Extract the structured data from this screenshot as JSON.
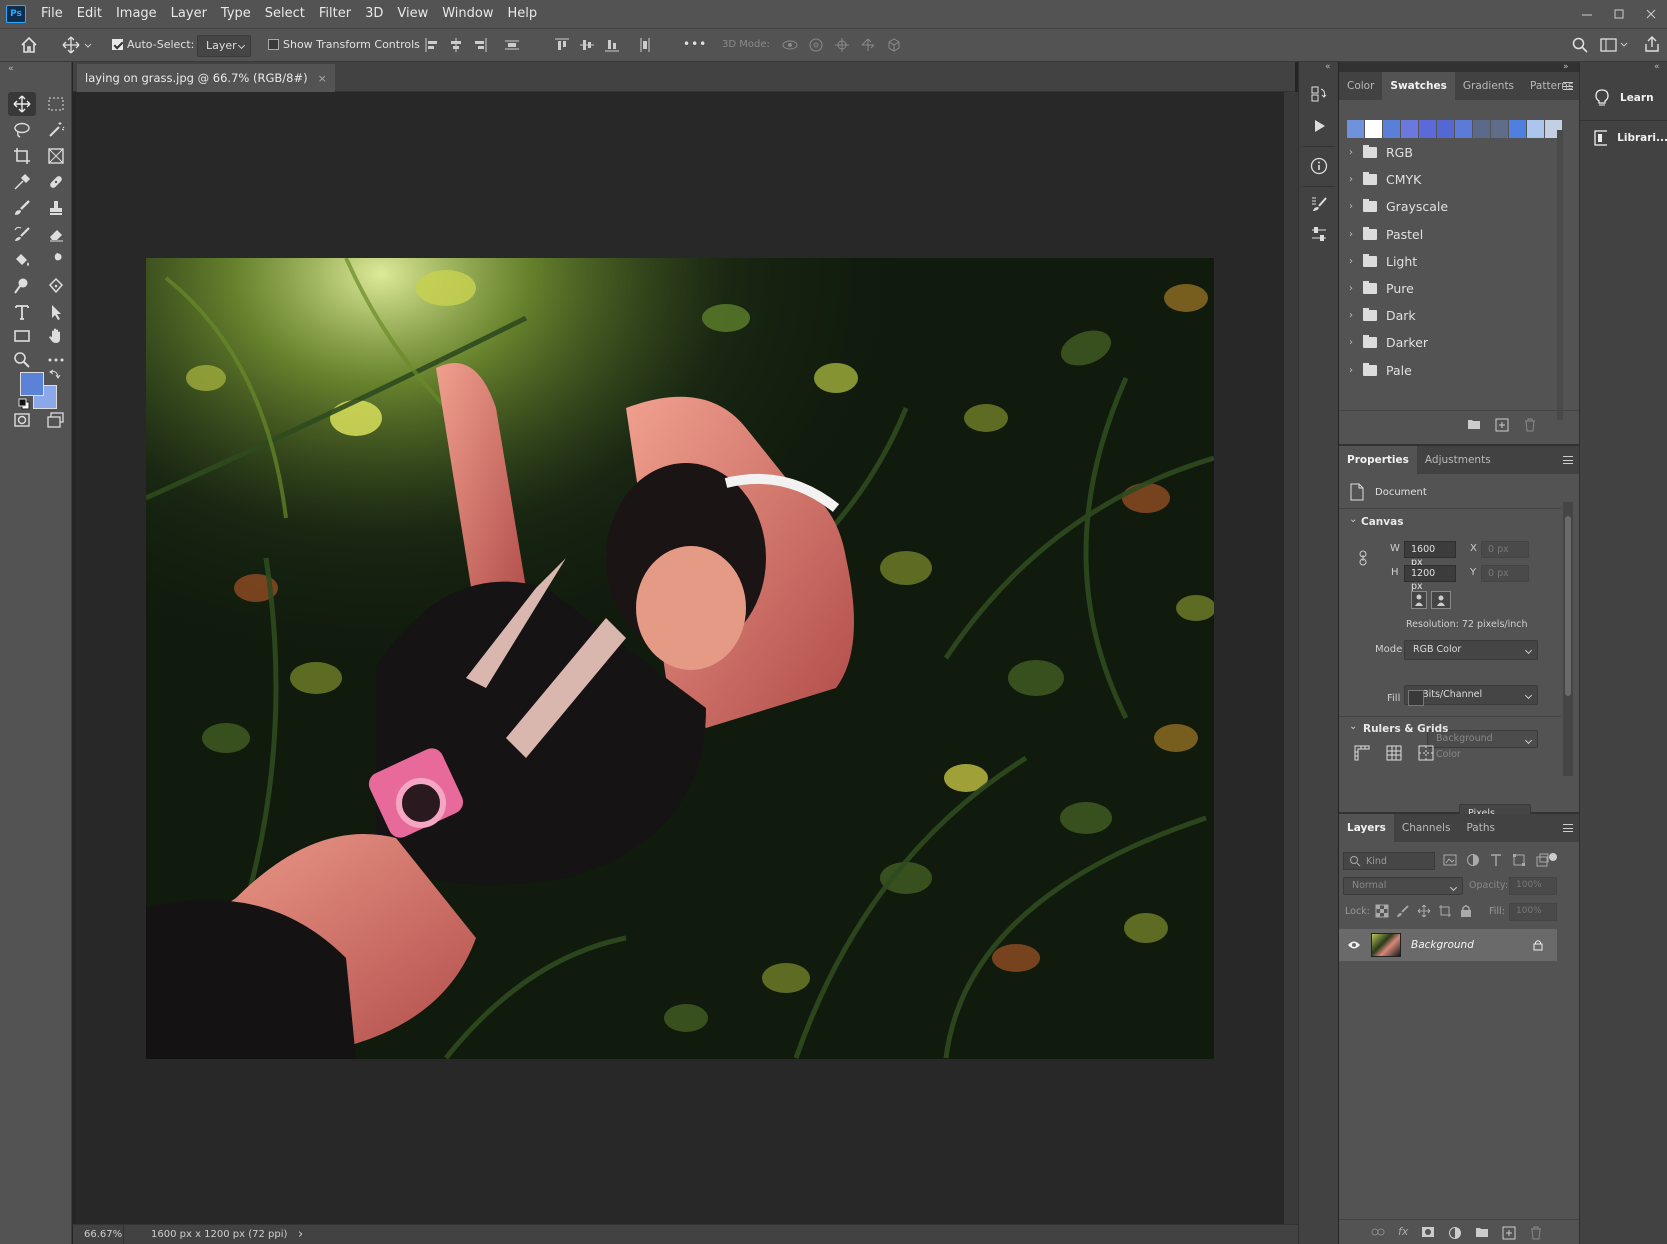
{
  "app": {
    "logo": "Ps",
    "menus": [
      "File",
      "Edit",
      "Image",
      "Layer",
      "Type",
      "Select",
      "Filter",
      "3D",
      "View",
      "Window",
      "Help"
    ],
    "window_controls": [
      "minimize-icon",
      "restore-icon",
      "close-icon"
    ]
  },
  "options_bar": {
    "auto_select_label": "Auto-Select:",
    "auto_select_checked": true,
    "target_value": "Layer",
    "show_transform_label": "Show Transform Controls",
    "show_transform_checked": false,
    "more_label": "•••",
    "mode_3d_label": "3D Mode:"
  },
  "document": {
    "tab_title": "laying on grass.jpg @ 66.7% (RGB/8#)",
    "tab_close": "×"
  },
  "status": {
    "zoom": "66.67%",
    "doc_info": "1600 px x 1200 px (72 ppi)",
    "arrow": "›"
  },
  "tools": {
    "foreground_color": "#5a82d6",
    "background_color": "#8aa8ea"
  },
  "swatches_panel": {
    "tabs": [
      "Color",
      "Swatches",
      "Gradients",
      "Patterns"
    ],
    "active_tab": "Swatches",
    "recent_swatches": [
      "#6f92dd",
      "#ffffff",
      "#5a7fd8",
      "#6b78dd",
      "#5c69d8",
      "#5468d4",
      "#5c7ad8",
      "#5b6a88",
      "#5f6c8a",
      "#4f80e0",
      "#aac6ee",
      "#c4cfe4"
    ],
    "groups": [
      "RGB",
      "CMYK",
      "Grayscale",
      "Pastel",
      "Light",
      "Pure",
      "Dark",
      "Darker",
      "Pale"
    ]
  },
  "properties_panel": {
    "tabs": [
      "Properties",
      "Adjustments"
    ],
    "active_tab": "Properties",
    "document_label": "Document",
    "canvas_section": "Canvas",
    "w_label": "W",
    "w_value": "1600 px",
    "h_label": "H",
    "h_value": "1200 px",
    "x_label": "X",
    "x_placeholder": "0 px",
    "y_label": "Y",
    "y_placeholder": "0 px",
    "resolution": "Resolution: 72 pixels/inch",
    "mode_label": "Mode",
    "mode_value": "RGB Color",
    "bits_value": "8 Bits/Channel",
    "fill_label": "Fill",
    "fill_value": "Background Color",
    "rulers_section": "Rulers & Grids",
    "units_value": "Pixels"
  },
  "layers_panel": {
    "tabs": [
      "Layers",
      "Channels",
      "Paths"
    ],
    "active_tab": "Layers",
    "kind_placeholder": "Kind",
    "blend_mode": "Normal",
    "opacity_label": "Opacity:",
    "opacity_value": "100%",
    "lock_label": "Lock:",
    "fill_label": "Fill:",
    "fill_value": "100%",
    "layers": [
      {
        "name": "Background",
        "visible": true,
        "locked": true
      }
    ]
  },
  "learn_strip": {
    "items": [
      "Learn",
      "Librari..."
    ]
  }
}
